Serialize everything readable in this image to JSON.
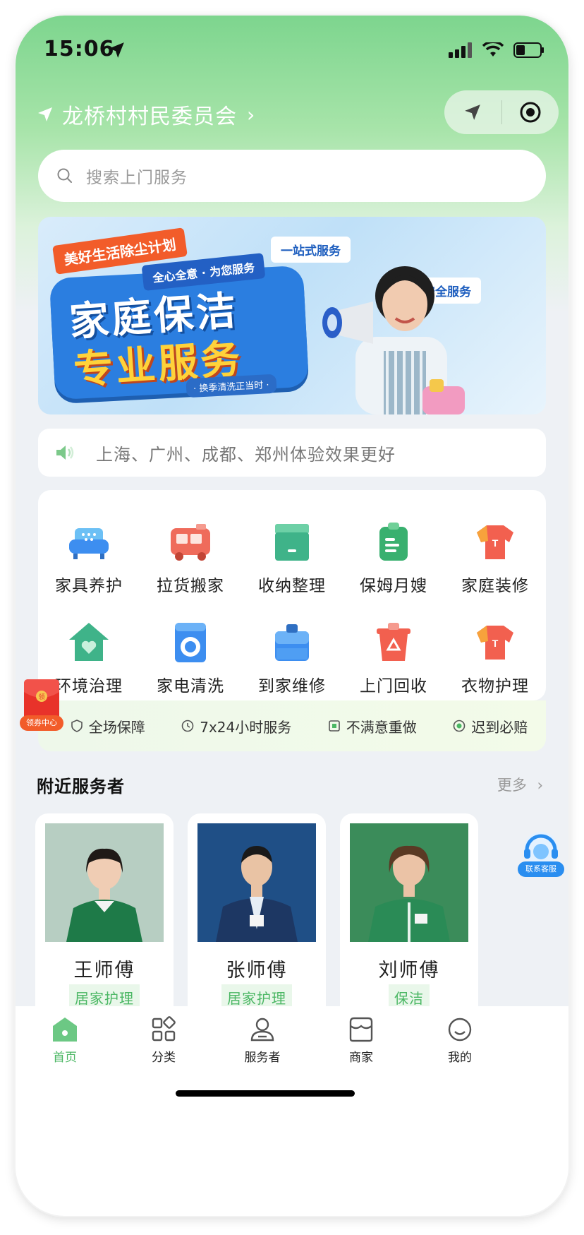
{
  "status_bar": {
    "time": "15:06"
  },
  "header": {
    "location": "龙桥村村民委员会"
  },
  "search": {
    "placeholder": "搜索上门服务"
  },
  "banner": {
    "tag_top": "美好生活除尘计划",
    "tag_sub": "全心全意 · 为您服务",
    "headline_1": "家庭保洁",
    "headline_2": "专业服务",
    "tag_bottom": "· 换季清洗正当时 ·",
    "chip_1": "一站式服务",
    "chip_2": "安全服务"
  },
  "notice": {
    "text": "上海、广州、成都、郑州体验效果更好"
  },
  "services": [
    {
      "label": "家具养护",
      "icon": "sofa-icon",
      "color": "#4aa8f0"
    },
    {
      "label": "拉货搬家",
      "icon": "truck-icon",
      "color": "#ef6b5b"
    },
    {
      "label": "收纳整理",
      "icon": "storage-box-icon",
      "color": "#3fb389"
    },
    {
      "label": "保姆月嫂",
      "icon": "clipboard-icon",
      "color": "#39b06f"
    },
    {
      "label": "家庭装修",
      "icon": "tshirt-icon",
      "color": "#f2604f"
    },
    {
      "label": "环境治理",
      "icon": "house-heart-icon",
      "color": "#3fb389"
    },
    {
      "label": "家电清洗",
      "icon": "washing-machine-icon",
      "color": "#3d8ef0"
    },
    {
      "label": "到家维修",
      "icon": "toolbox-icon",
      "color": "#3d8ef0"
    },
    {
      "label": "上门回收",
      "icon": "recycle-bin-icon",
      "color": "#f2604f"
    },
    {
      "label": "衣物护理",
      "icon": "tshirt-icon",
      "color": "#f2604f"
    }
  ],
  "guarantees": [
    {
      "label": "全场保障",
      "icon": "shield-icon"
    },
    {
      "label": "7x24小时服务",
      "icon": "clock-icon"
    },
    {
      "label": "不满意重做",
      "icon": "redo-icon"
    },
    {
      "label": "迟到必赔",
      "icon": "compensation-icon"
    }
  ],
  "coupon": {
    "label": "领券中心",
    "badge": "领"
  },
  "nearby": {
    "title": "附近服务者",
    "more": "更多",
    "workers": [
      {
        "name": "王师傅",
        "tag": "居家护理"
      },
      {
        "name": "张师傅",
        "tag": "居家护理"
      },
      {
        "name": "刘师傅",
        "tag": "保洁"
      }
    ]
  },
  "customer_service": {
    "label": "联系客服"
  },
  "tabbar": [
    {
      "label": "首页",
      "icon": "home-icon",
      "active": true
    },
    {
      "label": "分类",
      "icon": "category-grid-icon",
      "active": false
    },
    {
      "label": "服务者",
      "icon": "worker-icon",
      "active": false
    },
    {
      "label": "商家",
      "icon": "store-icon",
      "active": false
    },
    {
      "label": "我的",
      "icon": "profile-smile-icon",
      "active": false
    }
  ],
  "colors": {
    "brand_green": "#4bb764",
    "accent_orange": "#f25c2a",
    "accent_blue": "#2a8ef0"
  }
}
